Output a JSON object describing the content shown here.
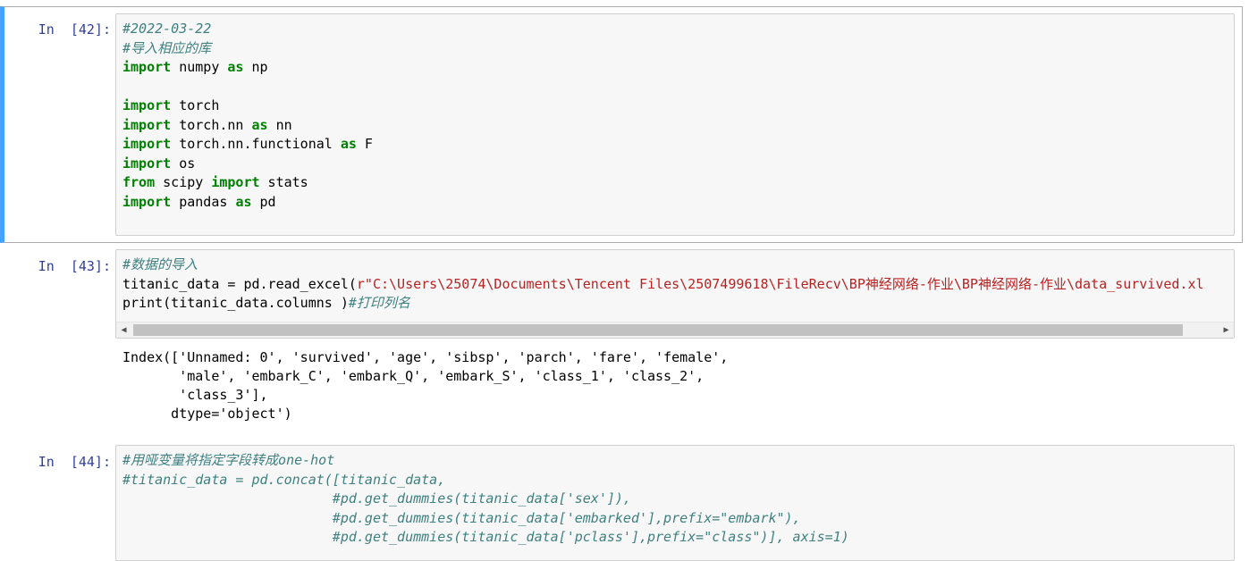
{
  "cells": [
    {
      "prompt": "In  [42]:",
      "lines": [
        "#2022-03-22",
        "#导入相应的库",
        "import numpy as np",
        "",
        "import torch",
        "import torch.nn as nn",
        "import torch.nn.functional as F",
        "import os",
        "from scipy import stats",
        "import pandas as pd"
      ]
    },
    {
      "prompt": "In  [43]:",
      "lines": [
        "#数据的导入",
        "titanic_data = pd.read_excel(r\"C:\\Users\\25074\\Documents\\Tencent Files\\2507499618\\FileRecv\\BP神经网络-作业\\BP神经网络-作业\\data_survived.xl",
        "print(titanic_data.columns )#打印列名"
      ],
      "output": [
        "Index(['Unnamed: 0', 'survived', 'age', 'sibsp', 'parch', 'fare', 'female',",
        "       'male', 'embark_C', 'embark_Q', 'embark_S', 'class_1', 'class_2',",
        "       'class_3'],",
        "      dtype='object')"
      ]
    },
    {
      "prompt": "In  [44]:",
      "lines": [
        "#用哑变量将指定字段转成one-hot",
        "#titanic_data = pd.concat([titanic_data,",
        "                          #pd.get_dummies(titanic_data['sex']),",
        "                          #pd.get_dummies(titanic_data['embarked'],prefix=\"embark\"),",
        "                          #pd.get_dummies(titanic_data['pclass'],prefix=\"class\")], axis=1)"
      ]
    }
  ],
  "scrollbar": {
    "left_arrow": "◀",
    "right_arrow": "▶"
  },
  "colors": {
    "selected_bar": "#42a5f5",
    "prompt": "#303f9f",
    "comment": "#408080",
    "keyword": "#008000",
    "string": "#ba2121",
    "input_bg": "#f7f7f7"
  }
}
